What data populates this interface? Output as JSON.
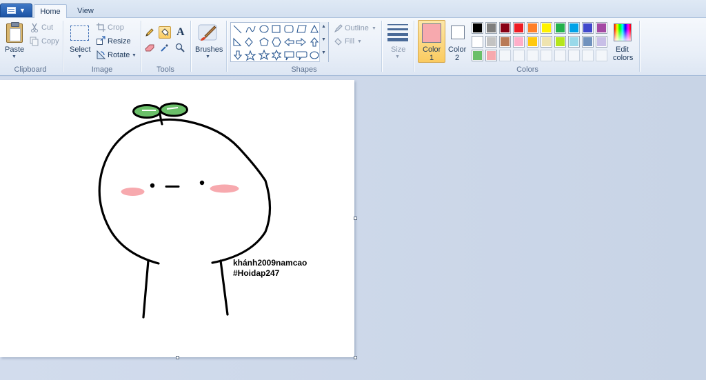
{
  "tabs": {
    "home": "Home",
    "view": "View"
  },
  "clipboard": {
    "paste": "Paste",
    "cut": "Cut",
    "copy": "Copy",
    "group": "Clipboard"
  },
  "image": {
    "select": "Select",
    "crop": "Crop",
    "resize": "Resize",
    "rotate": "Rotate",
    "group": "Image"
  },
  "tools": {
    "group": "Tools",
    "text_glyph": "A"
  },
  "brushes": {
    "label": "Brushes"
  },
  "shapes": {
    "outline": "Outline",
    "fill": "Fill",
    "group": "Shapes"
  },
  "size": {
    "label": "Size"
  },
  "colors": {
    "color1_label": "Color",
    "color1_num": "1",
    "color2_label": "Color",
    "color2_num": "2",
    "edit_label": "Edit",
    "edit_label2": "colors",
    "group": "Colors",
    "color1_value": "#f7a9ae",
    "color2_value": "#ffffff",
    "palette_row1": [
      "#000000",
      "#7f7f7f",
      "#880015",
      "#ed1c24",
      "#ff7f27",
      "#fff200",
      "#22b14c",
      "#00a2e8",
      "#3f48cc",
      "#a349a4"
    ],
    "palette_row2": [
      "#ffffff",
      "#c3c3c3",
      "#b97a57",
      "#ffaec9",
      "#ffc90e",
      "#efe4b0",
      "#b5e61d",
      "#99d9ea",
      "#7092be",
      "#c8bfe7"
    ],
    "palette_row3": [
      "#6abf69",
      "#f7a9ae",
      "",
      "",
      "",
      "",
      "",
      "",
      "",
      ""
    ]
  },
  "canvas": {
    "caption_line1": "khánh2009namcao",
    "caption_line2": "#Hoidap247"
  }
}
